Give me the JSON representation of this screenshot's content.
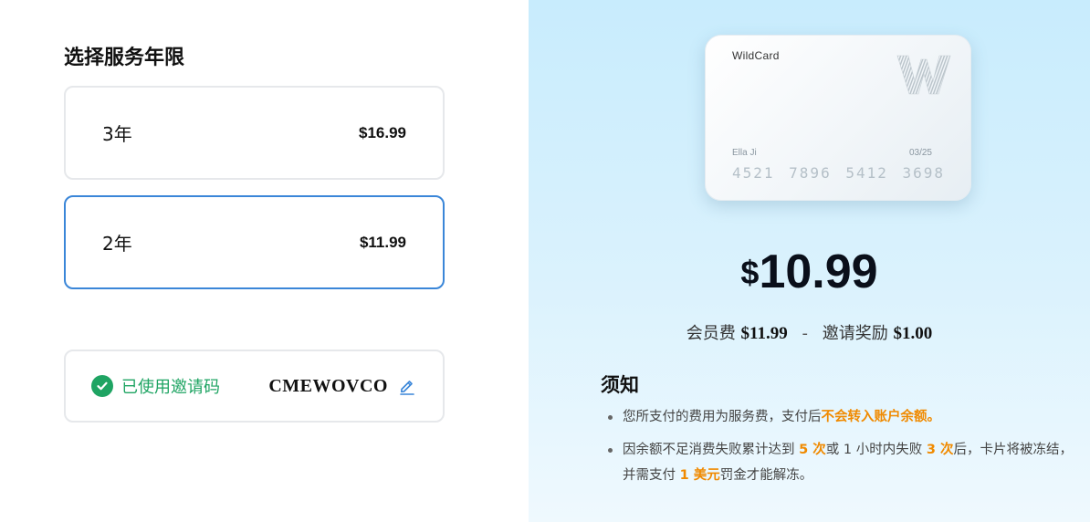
{
  "left": {
    "title": "选择服务年限",
    "plans": [
      {
        "label": "3年",
        "price": "$16.99",
        "selected": false
      },
      {
        "label": "2年",
        "price": "$11.99",
        "selected": true
      }
    ],
    "invite": {
      "status": "已使用邀请码",
      "code": "CMEWOVCO",
      "status_color": "#1fa463"
    }
  },
  "right": {
    "card": {
      "brand": "WildCard",
      "holder": "Ella Ji",
      "expiry": "03/25",
      "number": "4521 7896 5412 3698"
    },
    "price": {
      "currency": "$",
      "amount": "10.99"
    },
    "breakdown": {
      "fee_label": "会员费",
      "fee_value": "$11.99",
      "separator": "-",
      "reward_label": "邀请奖励",
      "reward_value": "$1.00"
    },
    "notice": {
      "title": "须知",
      "item1_pre": "您所支付的费用为服务费，支付后",
      "item1_hl": "不会转入账户余额。",
      "item2_p1": "因余额不足消费失败累计达到 ",
      "item2_h1": "5 次",
      "item2_p2": "或 1 小时内失败 ",
      "item2_h2": "3 次",
      "item2_p3": "后，卡片将被冻结，并需支付 ",
      "item2_h3": "1 美元",
      "item2_p4": "罚金才能解冻。"
    },
    "accent_color": "#f08a00",
    "selected_border_color": "#3a86d8"
  }
}
